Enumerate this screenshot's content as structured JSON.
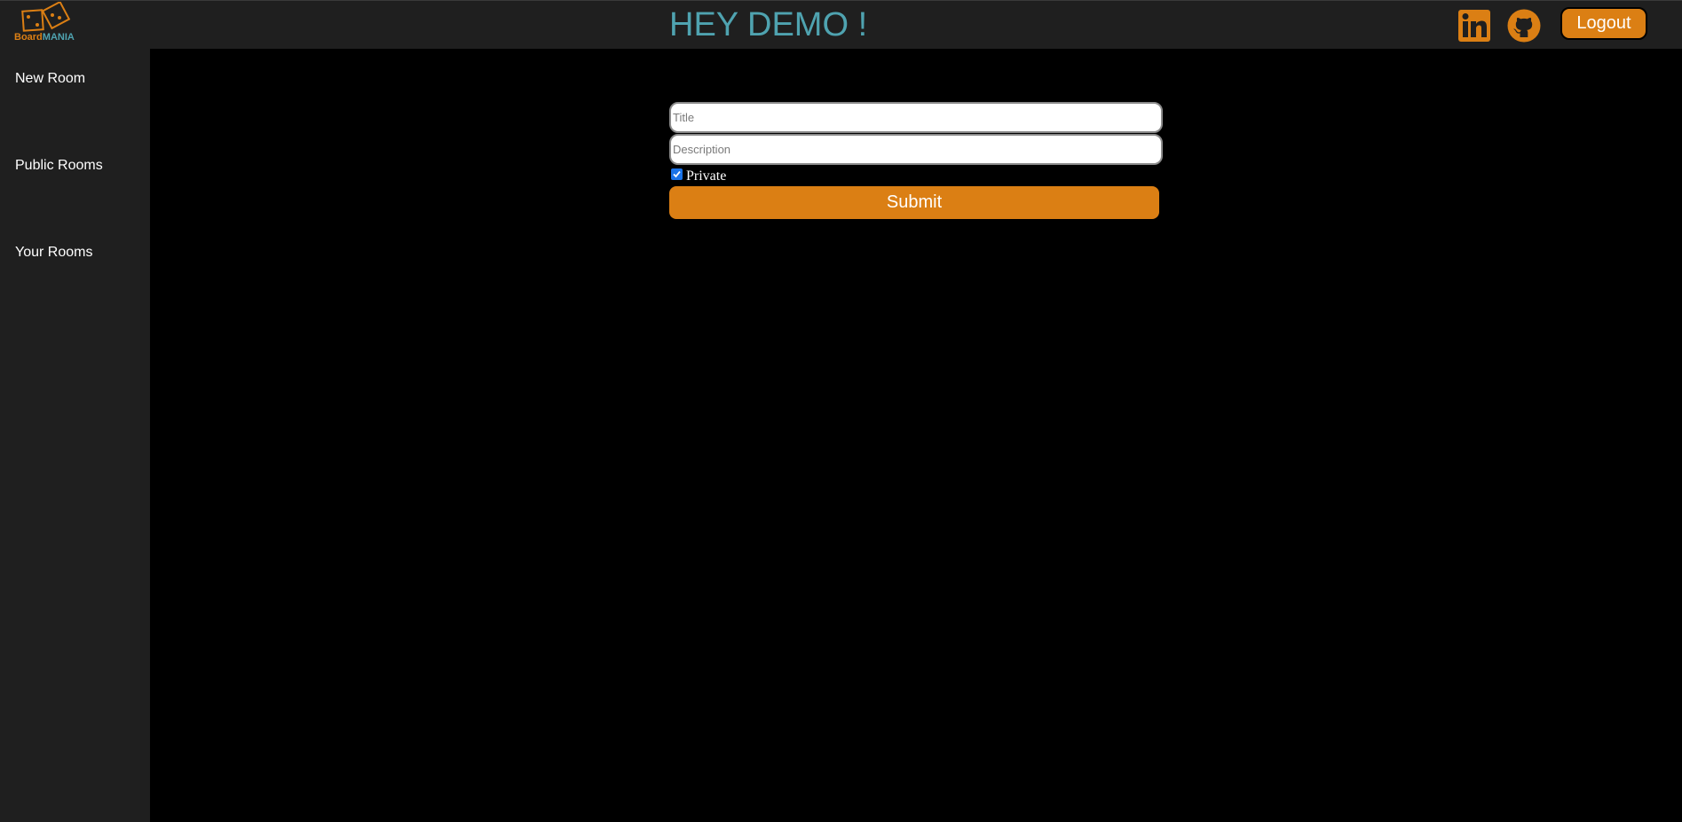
{
  "brand": {
    "logo_part1": "Board",
    "logo_part2": "MANIA",
    "logo_icon": "dice-icon",
    "accent_orange": "#db7f14",
    "accent_teal": "#4fa3b0"
  },
  "header": {
    "greeting": "HEY DEMO !",
    "linkedin_icon": "linkedin-icon",
    "github_icon": "github-icon",
    "logout_label": "Logout"
  },
  "sidebar": {
    "items": [
      {
        "label": "New Room"
      },
      {
        "label": "Public Rooms"
      },
      {
        "label": "Your Rooms"
      }
    ]
  },
  "form": {
    "title_placeholder": "Title",
    "title_value": "",
    "description_placeholder": "Description",
    "description_value": "",
    "private_label": "Private",
    "private_checked": true,
    "submit_label": "Submit"
  }
}
